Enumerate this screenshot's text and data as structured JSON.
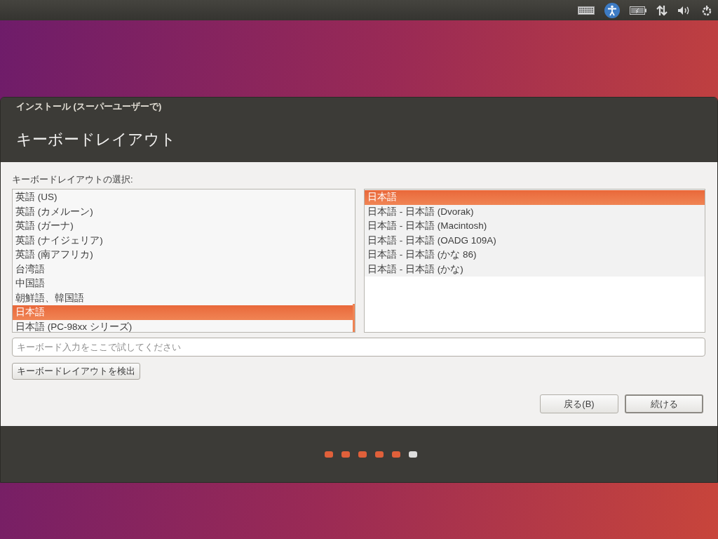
{
  "window": {
    "title": "インストール (スーパーユーザーで)",
    "heading": "キーボードレイアウト"
  },
  "prompt": "キーボードレイアウトの選択:",
  "layouts": [
    {
      "label": "英語 (US)",
      "selected": false
    },
    {
      "label": "英語 (カメルーン)",
      "selected": false
    },
    {
      "label": "英語 (ガーナ)",
      "selected": false
    },
    {
      "label": "英語 (ナイジェリア)",
      "selected": false
    },
    {
      "label": "英語 (南アフリカ)",
      "selected": false
    },
    {
      "label": "台湾語",
      "selected": false
    },
    {
      "label": "中国語",
      "selected": false
    },
    {
      "label": "朝鮮語、韓国語",
      "selected": false
    },
    {
      "label": "日本語",
      "selected": true
    },
    {
      "label": "日本語 (PC-98xx シリーズ)",
      "selected": false
    }
  ],
  "variants": [
    {
      "label": "日本語",
      "selected": true
    },
    {
      "label": "日本語 - 日本語 (Dvorak)",
      "selected": false
    },
    {
      "label": "日本語 - 日本語 (Macintosh)",
      "selected": false
    },
    {
      "label": "日本語 - 日本語 (OADG 109A)",
      "selected": false
    },
    {
      "label": "日本語 - 日本語 (かな 86)",
      "selected": false
    },
    {
      "label": "日本語 - 日本語 (かな)",
      "selected": false
    }
  ],
  "test_field": {
    "placeholder": "キーボード入力をここで試してください"
  },
  "detect_button": "キーボードレイアウトを検出",
  "buttons": [
    {
      "label": "戻る(B)",
      "default": false
    },
    {
      "label": "続ける",
      "default": true
    }
  ],
  "steps": [
    {
      "done": true
    },
    {
      "done": true
    },
    {
      "done": true
    },
    {
      "done": true
    },
    {
      "done": true
    },
    {
      "done": false
    }
  ]
}
